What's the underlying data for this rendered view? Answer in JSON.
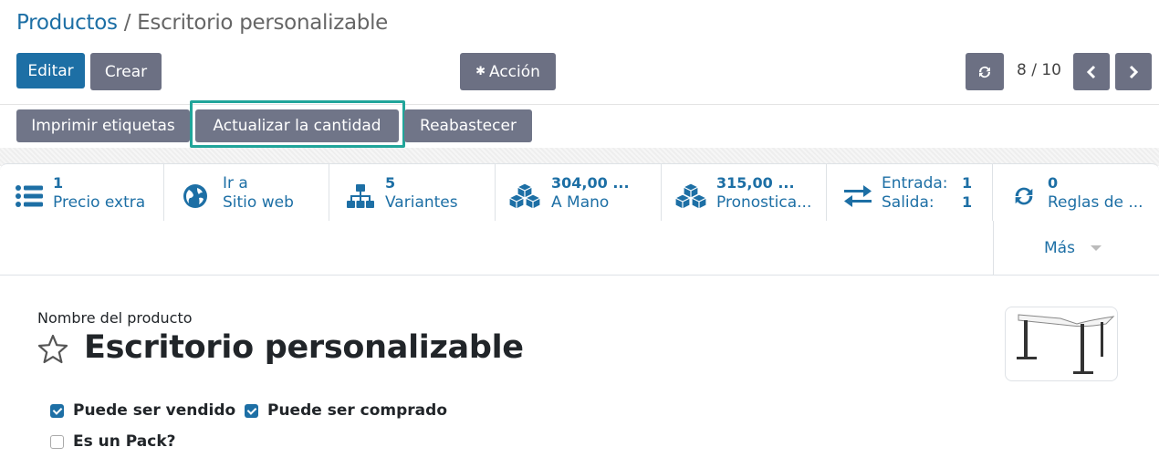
{
  "breadcrumb": {
    "parent": "Productos",
    "separator": "/",
    "current": "Escritorio personalizable"
  },
  "toolbar": {
    "edit": "Editar",
    "create": "Crear",
    "action": "Acción"
  },
  "pager": {
    "value": "8 / 10"
  },
  "header_buttons": {
    "print_labels": "Imprimir etiquetas",
    "update_qty": "Actualizar la cantidad",
    "replenish": "Reabastecer"
  },
  "smart_buttons": {
    "extra_price": {
      "value": "1",
      "label": "Precio extra",
      "icon": "list-icon"
    },
    "website": {
      "line1": "Ir a",
      "line2": "Sitio web",
      "icon": "globe-icon"
    },
    "variants": {
      "value": "5",
      "label": "Variantes",
      "icon": "sitemap-icon"
    },
    "on_hand": {
      "value": "304,00 ...",
      "label": "A Mano",
      "icon": "cubes-icon"
    },
    "forecasted": {
      "value": "315,00 ...",
      "label": "Pronostica...",
      "icon": "cubes-icon"
    },
    "moves": {
      "in_label": "Entrada:",
      "in_value": "1",
      "out_label": "Salida:",
      "out_value": "1",
      "icon": "exchange-icon"
    },
    "rules": {
      "value": "0",
      "label": "Reglas de ...",
      "icon": "refresh-icon"
    },
    "more": "Más"
  },
  "product": {
    "name_label": "Nombre del producto",
    "name": "Escritorio personalizable",
    "can_be_sold": "Puede ser vendido",
    "can_be_purchased": "Puede ser comprado",
    "is_pack": "Es un Pack?"
  },
  "colors": {
    "primary": "#1d6fa5",
    "secondary": "#6c7083",
    "highlight": "#21a59a"
  }
}
